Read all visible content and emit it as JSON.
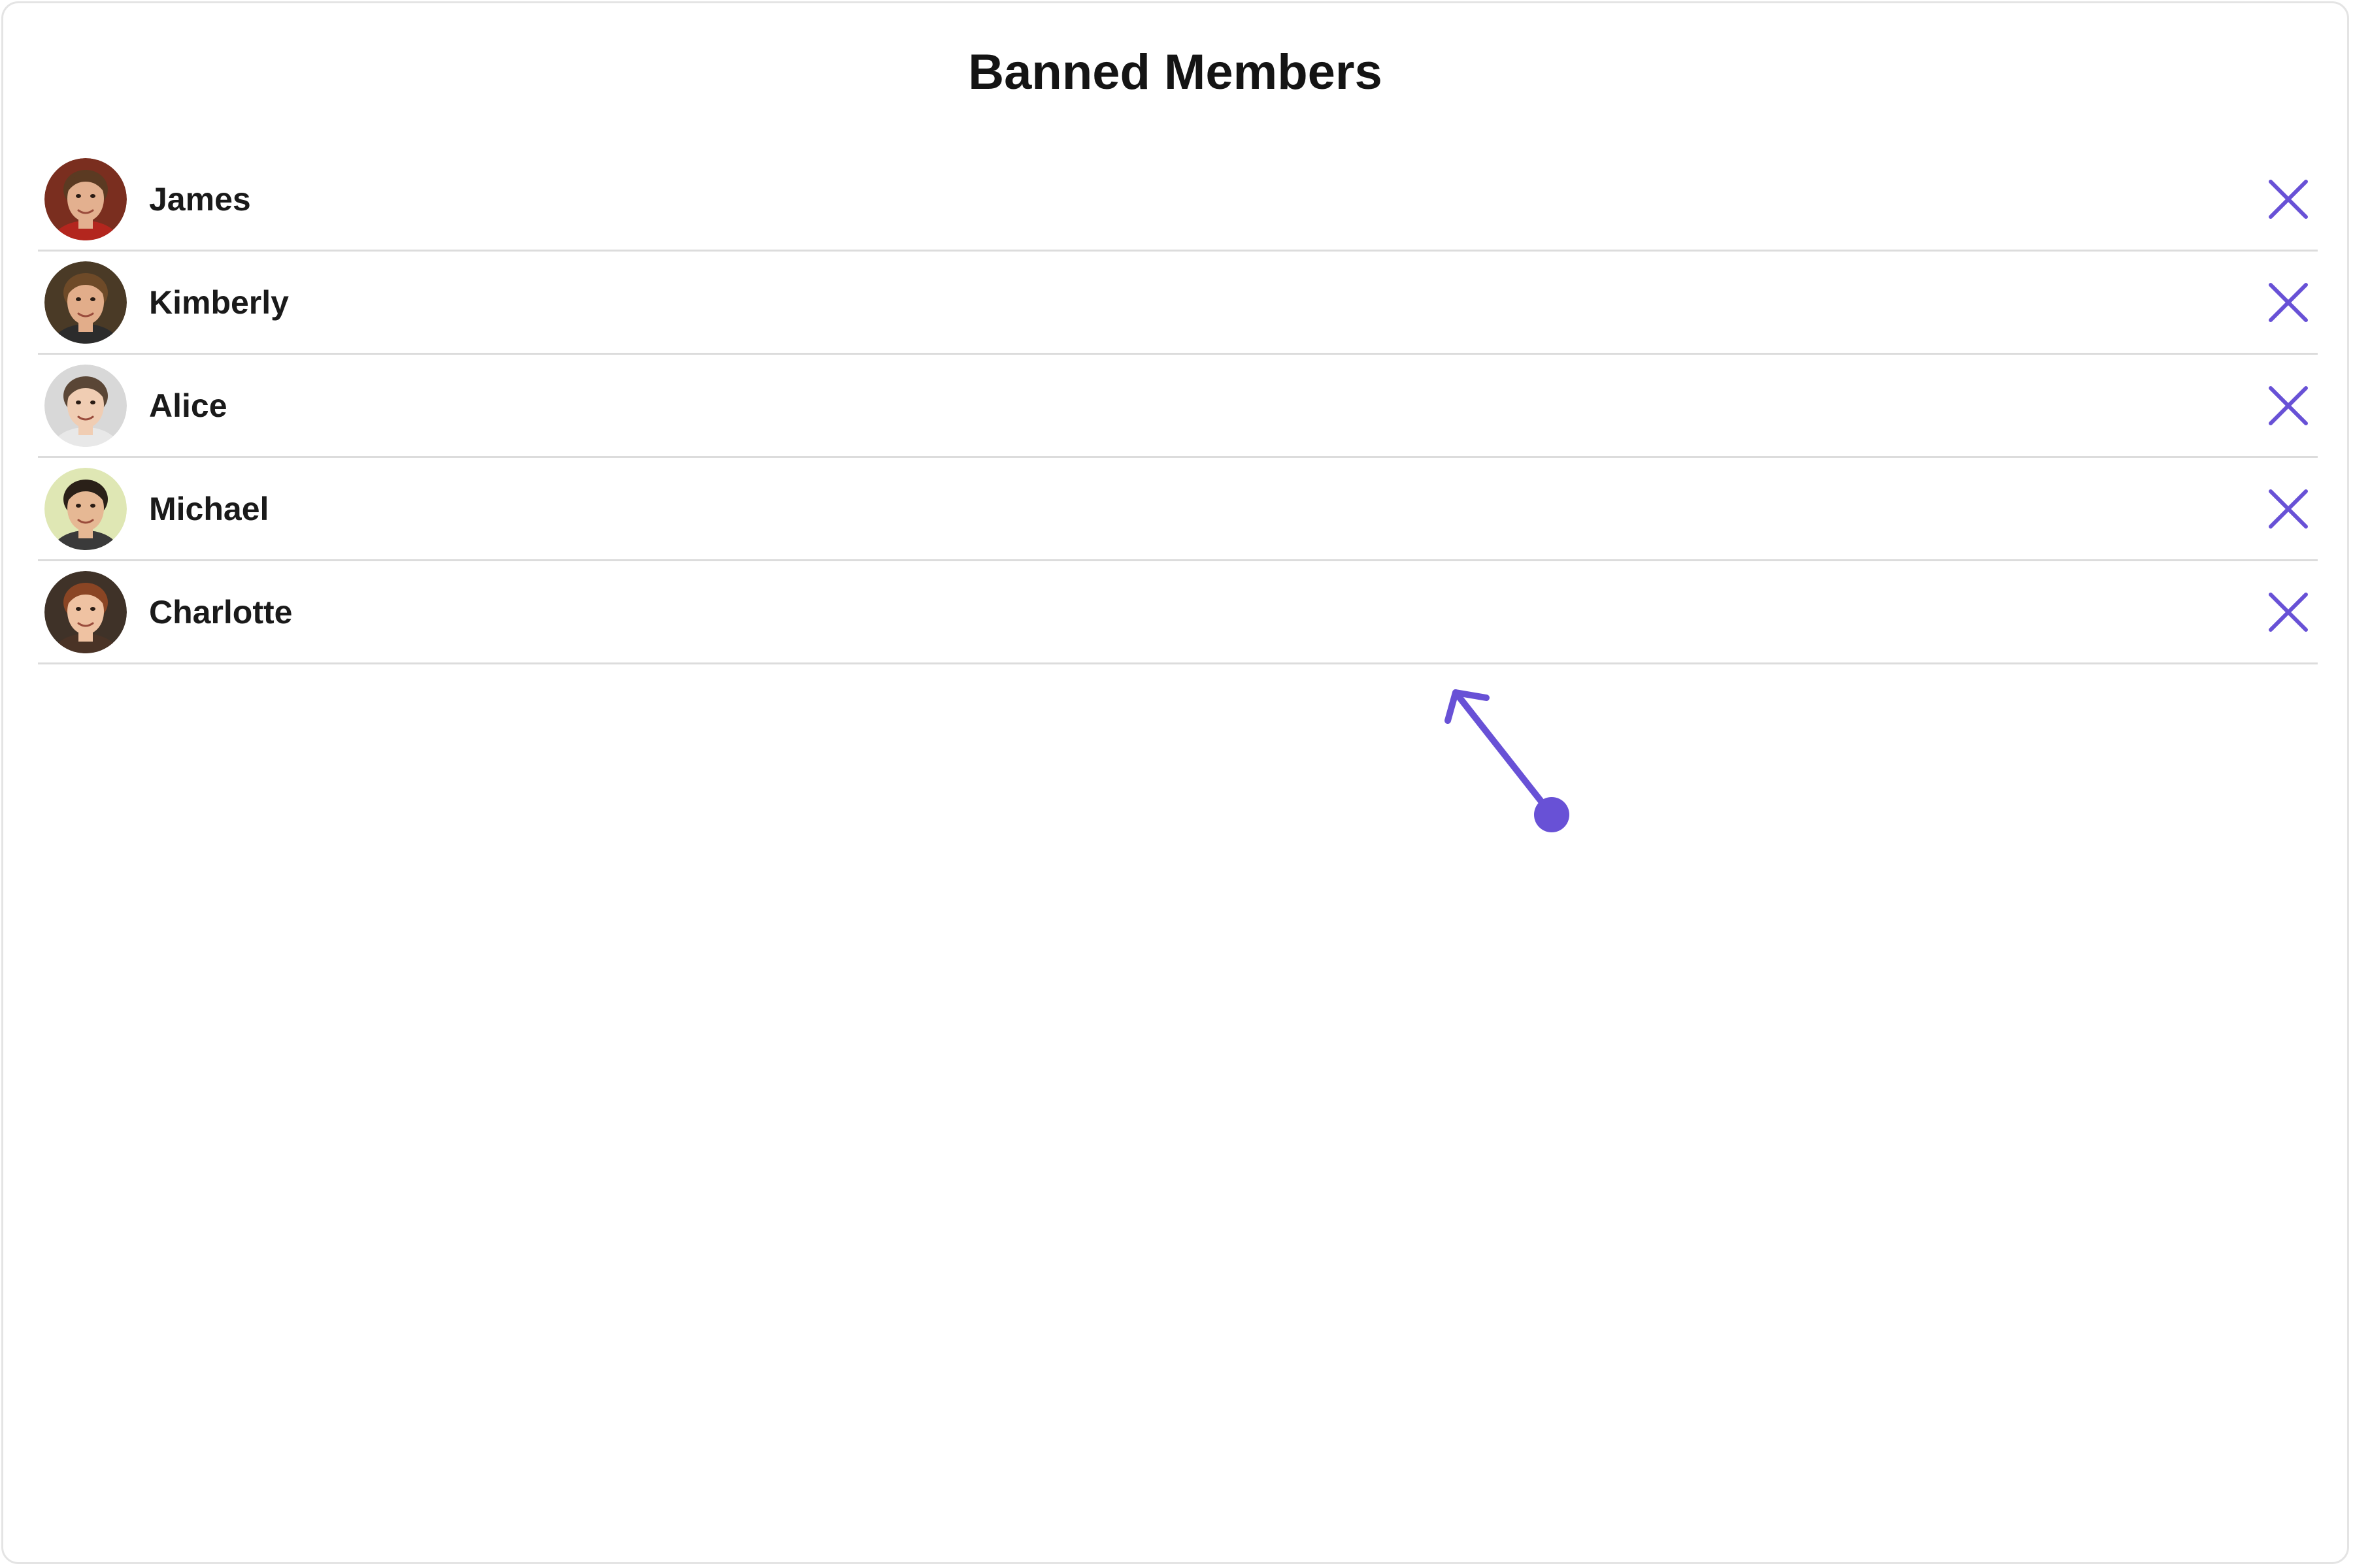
{
  "header": {
    "title": "Banned Members"
  },
  "members": [
    {
      "name": "James",
      "avatar": {
        "bg": "#7a2e1f",
        "skin": "#e3b08f",
        "hair": "#5b3a22",
        "shirt": "#b3261e"
      }
    },
    {
      "name": "Kimberly",
      "avatar": {
        "bg": "#4a3a26",
        "skin": "#e2ad8a",
        "hair": "#6e4a28",
        "shirt": "#2c2c2c"
      }
    },
    {
      "name": "Alice",
      "avatar": {
        "bg": "#d8d8d8",
        "skin": "#f0cdb3",
        "hair": "#5a4636",
        "shirt": "#e8e8e8"
      }
    },
    {
      "name": "Michael",
      "avatar": {
        "bg": "#dfe7b4",
        "skin": "#e6b894",
        "hair": "#2a2018",
        "shirt": "#3a3a3a"
      }
    },
    {
      "name": "Charlotte",
      "avatar": {
        "bg": "#3f3228",
        "skin": "#efc2a2",
        "hair": "#8a4524",
        "shirt": "#4a3326"
      }
    }
  ],
  "icons": {
    "unban": "close-icon",
    "cursor": "gesture-arrow-icon"
  },
  "colors": {
    "accent": "#6851d6",
    "title": "#141414",
    "divider": "#dcdcdc"
  }
}
